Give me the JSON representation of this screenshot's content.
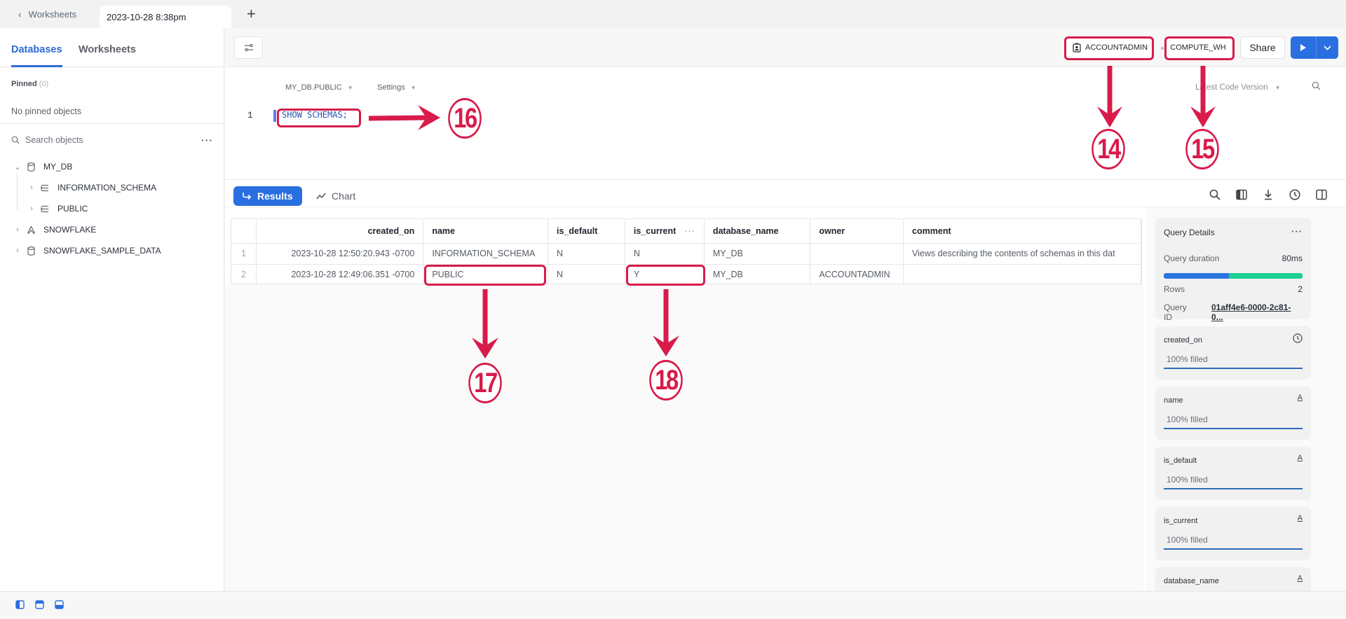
{
  "tabstrip": {
    "back_label": "Worksheets",
    "active_tab": "2023-10-28 8:38pm",
    "add_tab_icon": "plus-icon"
  },
  "sidebar": {
    "tabs": [
      {
        "label": "Databases",
        "active": true
      },
      {
        "label": "Worksheets",
        "active": false
      }
    ],
    "pinned_label": "Pinned",
    "pinned_count": "(0)",
    "no_pinned_text": "No pinned objects",
    "search_placeholder": "Search objects",
    "tree": [
      {
        "label": "MY_DB",
        "icon": "database-icon",
        "expanded": true,
        "level": 0
      },
      {
        "label": "INFORMATION_SCHEMA",
        "icon": "schema-icon",
        "expanded": false,
        "level": 1
      },
      {
        "label": "PUBLIC",
        "icon": "schema-icon",
        "expanded": false,
        "level": 1
      },
      {
        "label": "SNOWFLAKE",
        "icon": "snowflake-share-icon",
        "expanded": false,
        "level": 0
      },
      {
        "label": "SNOWFLAKE_SAMPLE_DATA",
        "icon": "database-icon",
        "expanded": false,
        "level": 0
      }
    ]
  },
  "toolbar": {
    "role": "ACCOUNTADMIN",
    "warehouse": "COMPUTE_WH",
    "share_label": "Share"
  },
  "editor": {
    "context": "MY_DB.PUBLIC",
    "settings_label": "Settings",
    "version_label": "Latest Code Version",
    "lines": [
      {
        "number": "1",
        "code": "SHOW SCHEMAS;"
      }
    ]
  },
  "results": {
    "tabs": [
      {
        "label": "Results",
        "active": true
      },
      {
        "label": "Chart",
        "active": false
      }
    ],
    "columns": [
      "created_on",
      "name",
      "is_default",
      "is_current",
      "database_name",
      "owner",
      "comment"
    ],
    "rows": [
      {
        "idx": "1",
        "created_on": "2023-10-28 12:50:20.943 -0700",
        "name": "INFORMATION_SCHEMA",
        "is_default": "N",
        "is_current": "N",
        "database_name": "MY_DB",
        "owner": "",
        "comment": "Views describing the contents of schemas in this dat"
      },
      {
        "idx": "2",
        "created_on": "2023-10-28 12:49:06.351 -0700",
        "name": "PUBLIC",
        "is_default": "N",
        "is_current": "Y",
        "database_name": "MY_DB",
        "owner": "ACCOUNTADMIN",
        "comment": ""
      }
    ]
  },
  "query_details": {
    "title": "Query Details",
    "duration_label": "Query duration",
    "duration_value": "80ms",
    "duration_split_fraction": 0.47,
    "rows_label": "Rows",
    "rows_value": "2",
    "query_id_label": "Query ID",
    "query_id_value": "01aff4e6-0000-2c81-0...",
    "column_cards": [
      {
        "name": "created_on",
        "type_icon": "clock-icon",
        "filled": "100% filled"
      },
      {
        "name": "name",
        "type_icon": "text-type-icon",
        "filled": "100% filled"
      },
      {
        "name": "is_default",
        "type_icon": "text-type-icon",
        "filled": "100% filled"
      },
      {
        "name": "is_current",
        "type_icon": "text-type-icon",
        "filled": "100% filled"
      },
      {
        "name": "database_name",
        "type_icon": "text-type-icon",
        "filled": ""
      }
    ]
  },
  "annotations": {
    "color": "#d81b4a",
    "labels": [
      "14",
      "15",
      "16",
      "17",
      "18"
    ]
  }
}
